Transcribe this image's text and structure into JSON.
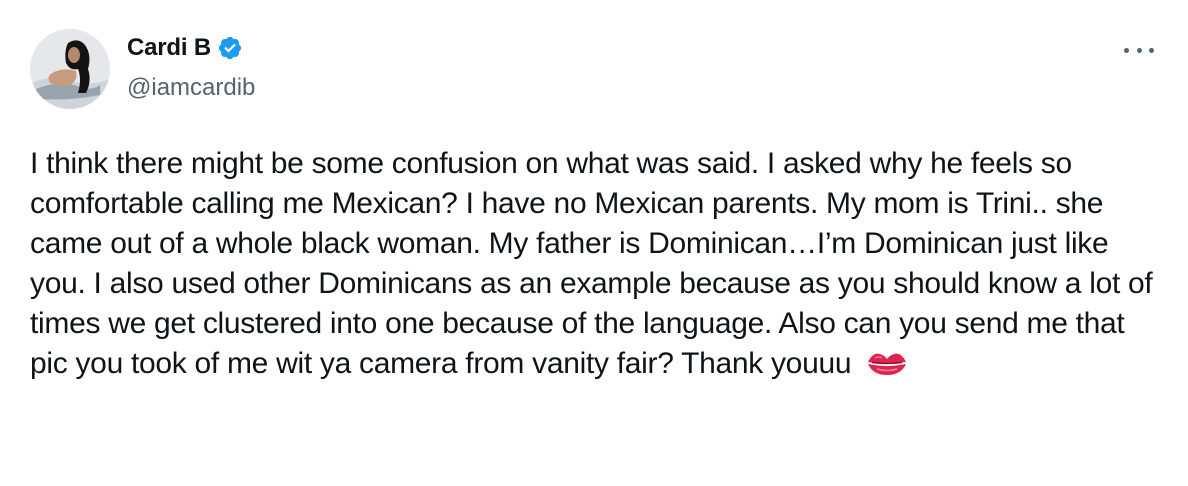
{
  "author": {
    "name": "Cardi B",
    "handle": "@iamcardib",
    "verified": true,
    "verified_color": "#1d9bf0"
  },
  "tweet": {
    "text": "I think there might be some confusion on what was said. I asked why he feels so comfortable calling me Mexican? I have no Mexican parents. My mom is Trini.. she came out of a whole black woman. My father is Dominican…I’m Dominican just like you. I also used other Dominicans as an example because as you should know a lot of times we get clustered into one because of the language. Also can you send me that pic you took of me wit ya camera from vanity fair? Thank youuu ",
    "trailing_emoji": "kiss-mark-icon"
  },
  "icons": {
    "more": "more-options-icon",
    "verified": "verified-badge-icon"
  }
}
